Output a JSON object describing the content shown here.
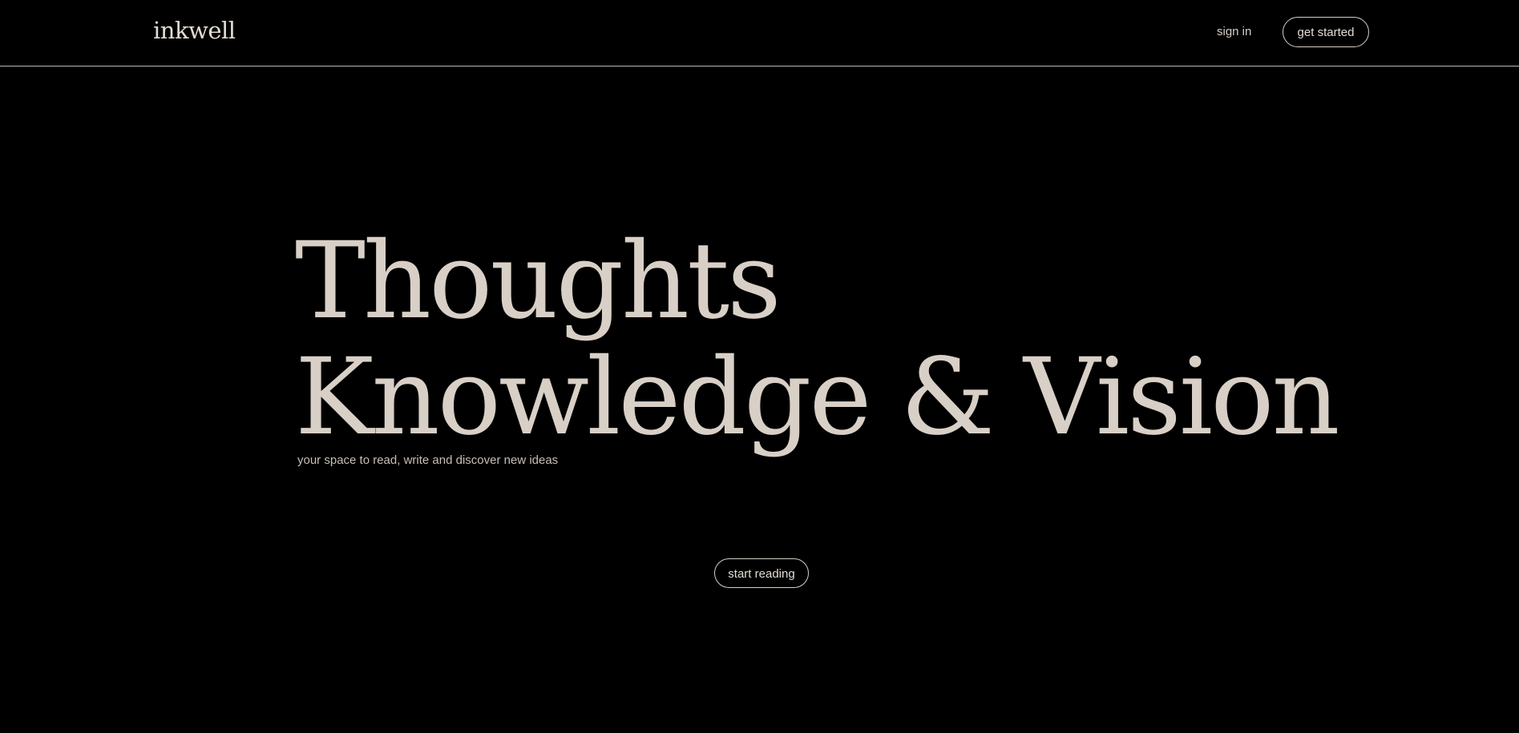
{
  "nav": {
    "logo": "inkwell",
    "sign_in": "sign in",
    "get_started": "get started"
  },
  "hero": {
    "line1": "Thoughts",
    "line2": "Knowledge & Vision",
    "tagline": "your space to read, write and discover new ideas",
    "cta": "start reading"
  },
  "colors": {
    "background": "#000000",
    "text": "#d6cec6",
    "divider": "#bdb6ae"
  }
}
